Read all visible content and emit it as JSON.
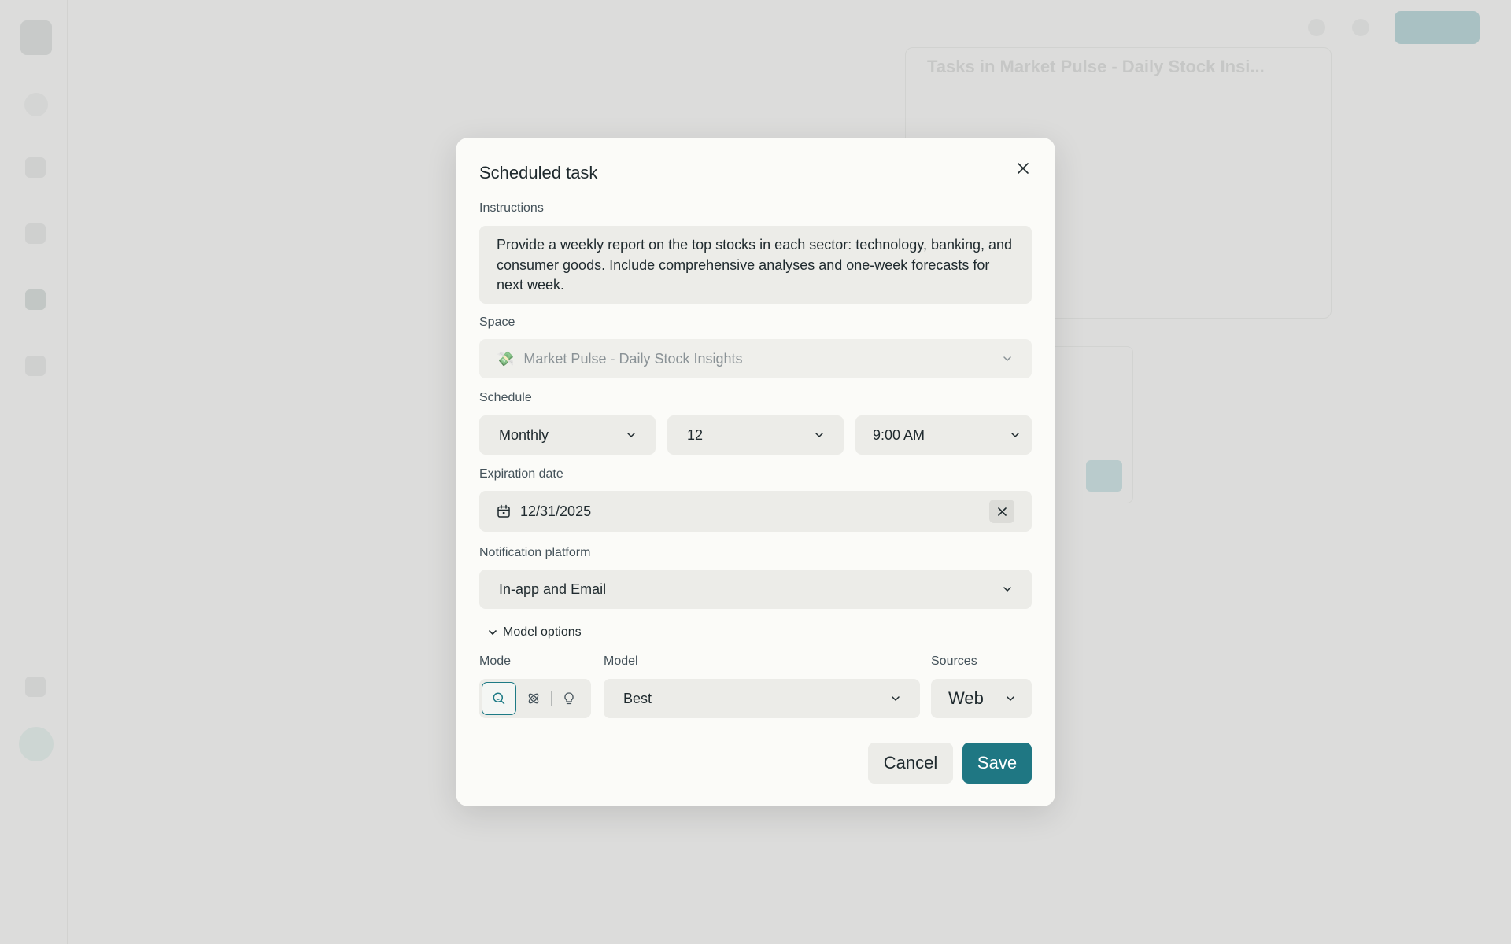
{
  "background": {
    "panel_title": "Tasks in Market Pulse - Daily Stock Insi..."
  },
  "modal": {
    "title": "Scheduled task",
    "instructions_label": "Instructions",
    "instructions_text": "Provide a weekly report on the top stocks in each sector: technology, banking, and consumer goods. Include comprehensive analyses and one-week forecasts for next week.",
    "space_label": "Space",
    "space_emoji": "💸",
    "space_value": "Market Pulse - Daily Stock Insights",
    "schedule_label": "Schedule",
    "schedule_frequency": "Monthly",
    "schedule_day": "12",
    "schedule_time": "9:00 AM",
    "expiration_label": "Expiration date",
    "expiration_value": "12/31/2025",
    "notification_label": "Notification platform",
    "notification_value": "In-app and Email",
    "model_options_label": "Model options",
    "mode_label": "Mode",
    "model_label": "Model",
    "model_value": "Best",
    "sources_label": "Sources",
    "sources_value": "Web",
    "cancel_label": "Cancel",
    "save_label": "Save"
  },
  "colors": {
    "accent": "#1f7783",
    "field_bg": "#ecece8",
    "modal_bg": "#fbfbf8"
  },
  "icons": [
    "close-icon",
    "chevron-down-icon",
    "calendar-icon",
    "search-icon",
    "atom-icon",
    "lightbulb-icon"
  ]
}
